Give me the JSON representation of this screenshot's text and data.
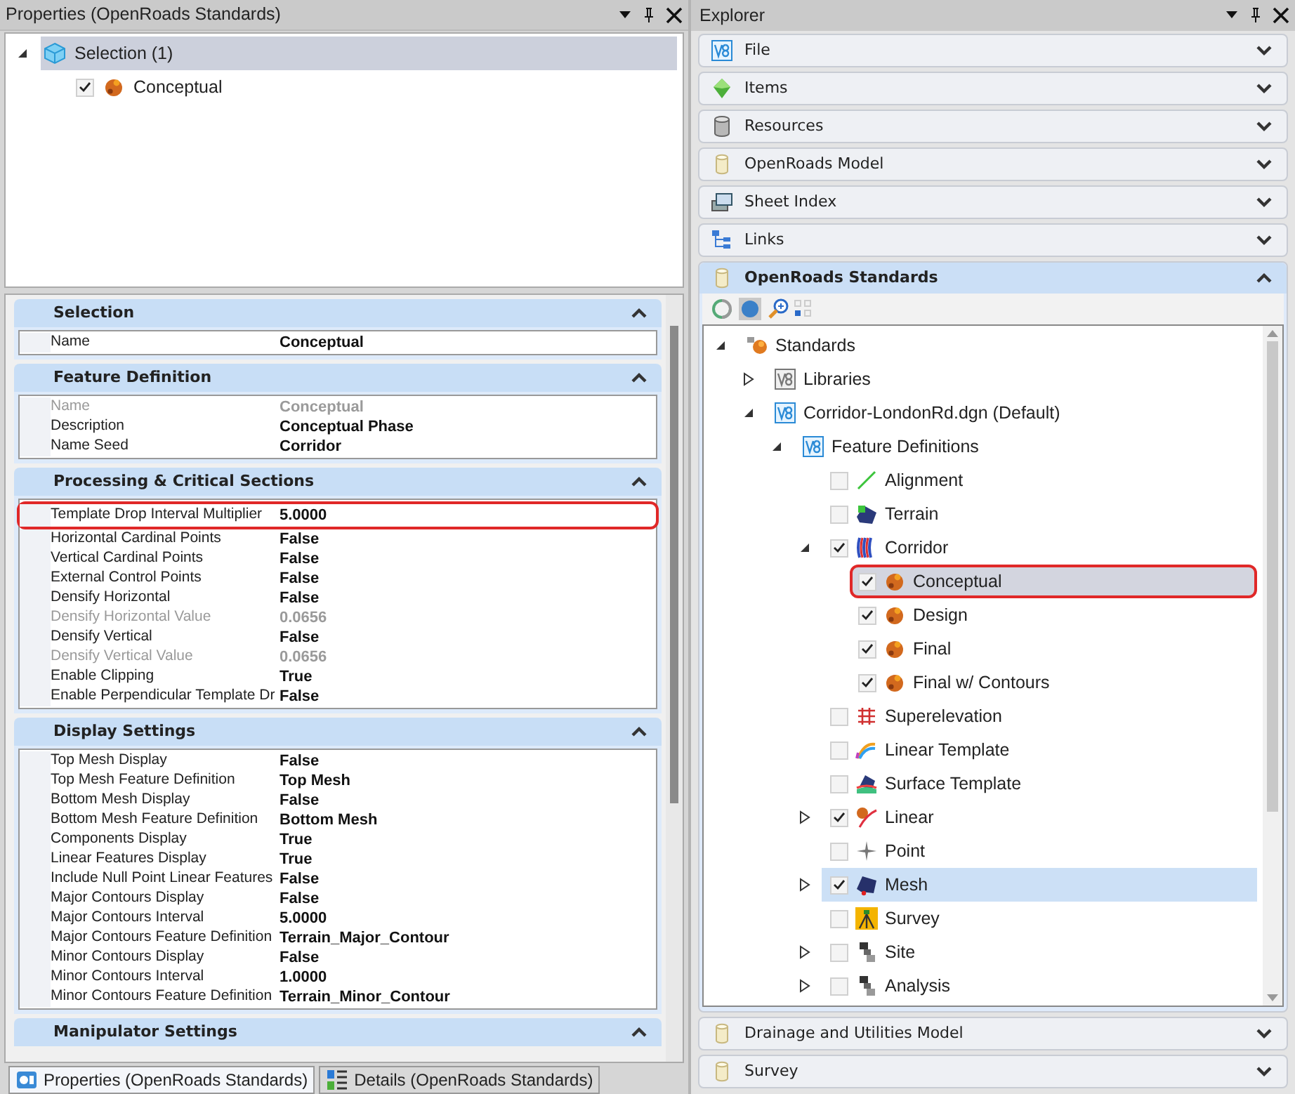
{
  "properties_panel": {
    "title": "Properties (OpenRoads Standards)",
    "selection_tree": [
      {
        "label": "Selection (1)",
        "kind": "cube",
        "expanded": true,
        "selected": true,
        "children": [
          {
            "label": "Conceptual",
            "kind": "palette",
            "checked": true,
            "selected": false
          }
        ]
      }
    ],
    "sections": [
      {
        "title": "Selection",
        "expanded": true,
        "rows": [
          {
            "name": "Name",
            "value": "Conceptual",
            "disabled": false,
            "highlighted": false
          }
        ]
      },
      {
        "title": "Feature Definition",
        "expanded": true,
        "rows": [
          {
            "name": "Name",
            "value": "Conceptual",
            "disabled": true,
            "highlighted": false
          },
          {
            "name": "Description",
            "value": "Conceptual Phase",
            "disabled": false,
            "highlighted": false
          },
          {
            "name": "Name Seed",
            "value": "Corridor",
            "disabled": false,
            "highlighted": false
          }
        ]
      },
      {
        "title": "Processing & Critical Sections",
        "expanded": true,
        "rows": [
          {
            "name": "Template Drop Interval Multiplier",
            "value": "5.0000",
            "disabled": false,
            "highlighted": true
          },
          {
            "name": "Horizontal Cardinal Points",
            "value": "False",
            "disabled": false,
            "highlighted": false
          },
          {
            "name": "Vertical Cardinal Points",
            "value": "False",
            "disabled": false,
            "highlighted": false
          },
          {
            "name": "External Control Points",
            "value": "False",
            "disabled": false,
            "highlighted": false
          },
          {
            "name": "Densify Horizontal",
            "value": "False",
            "disabled": false,
            "highlighted": false
          },
          {
            "name": "Densify Horizontal Value",
            "value": "0.0656",
            "disabled": true,
            "highlighted": false
          },
          {
            "name": "Densify Vertical",
            "value": "False",
            "disabled": false,
            "highlighted": false
          },
          {
            "name": "Densify Vertical Value",
            "value": "0.0656",
            "disabled": true,
            "highlighted": false
          },
          {
            "name": "Enable Clipping",
            "value": "True",
            "disabled": false,
            "highlighted": false
          },
          {
            "name": "Enable Perpendicular Template Dr",
            "value": "False",
            "disabled": false,
            "highlighted": false
          }
        ]
      },
      {
        "title": "Display Settings",
        "expanded": true,
        "rows": [
          {
            "name": "Top Mesh Display",
            "value": "False",
            "disabled": false,
            "highlighted": false
          },
          {
            "name": "Top Mesh Feature Definition",
            "value": "Top Mesh",
            "disabled": false,
            "highlighted": false
          },
          {
            "name": "Bottom Mesh Display",
            "value": "False",
            "disabled": false,
            "highlighted": false
          },
          {
            "name": "Bottom Mesh Feature Definition",
            "value": "Bottom Mesh",
            "disabled": false,
            "highlighted": false
          },
          {
            "name": "Components Display",
            "value": "True",
            "disabled": false,
            "highlighted": false
          },
          {
            "name": "Linear Features Display",
            "value": "True",
            "disabled": false,
            "highlighted": false
          },
          {
            "name": "Include Null Point Linear Features",
            "value": "False",
            "disabled": false,
            "highlighted": false
          },
          {
            "name": "Major Contours Display",
            "value": "False",
            "disabled": false,
            "highlighted": false
          },
          {
            "name": "Major Contours Interval",
            "value": "5.0000",
            "disabled": false,
            "highlighted": false
          },
          {
            "name": "Major Contours Feature Definition",
            "value": "Terrain_Major_Contour",
            "disabled": false,
            "highlighted": false
          },
          {
            "name": "Minor Contours Display",
            "value": "False",
            "disabled": false,
            "highlighted": false
          },
          {
            "name": "Minor Contours Interval",
            "value": "1.0000",
            "disabled": false,
            "highlighted": false
          },
          {
            "name": "Minor Contours Feature Definition",
            "value": "Terrain_Minor_Contour",
            "disabled": false,
            "highlighted": false
          }
        ]
      },
      {
        "title": "Manipulator Settings",
        "expanded": true
      }
    ],
    "tabs": [
      {
        "label": "Properties (OpenRoads Standards)",
        "kind": "properties",
        "selected": true
      },
      {
        "label": "Details (OpenRoads Standards)",
        "kind": "details",
        "selected": false
      }
    ]
  },
  "explorer": {
    "title": "Explorer",
    "sections": [
      {
        "label": "File",
        "kind": "v8",
        "expanded": false
      },
      {
        "label": "Items",
        "kind": "items",
        "expanded": false
      },
      {
        "label": "Resources",
        "kind": "resources",
        "expanded": false
      },
      {
        "label": "OpenRoads Model",
        "kind": "database",
        "expanded": false
      },
      {
        "label": "Sheet Index",
        "kind": "sheets",
        "expanded": false
      },
      {
        "label": "Links",
        "kind": "links",
        "expanded": false
      },
      {
        "label": "OpenRoads Standards",
        "kind": "database",
        "expanded": true,
        "tree": [
          {
            "label": "Standards",
            "kind": "standards",
            "expanded": true,
            "selected": false,
            "highlighted": false,
            "children": [
              {
                "label": "Libraries",
                "kind": "v8gray",
                "expanded": false,
                "selected": false,
                "highlighted": false
              },
              {
                "label": "Corridor-LondonRd.dgn (Default)",
                "kind": "v8",
                "expanded": true,
                "selected": false,
                "highlighted": false,
                "children": [
                  {
                    "label": "Feature Definitions",
                    "kind": "v8",
                    "expanded": true,
                    "selected": false,
                    "highlighted": false,
                    "children": [
                      {
                        "label": "Alignment",
                        "kind": "alignment",
                        "checked": false,
                        "selected": false,
                        "highlighted": false
                      },
                      {
                        "label": "Terrain",
                        "kind": "terrain",
                        "checked": false,
                        "selected": false,
                        "highlighted": false
                      },
                      {
                        "label": "Corridor",
                        "kind": "corridor",
                        "expanded": true,
                        "checked": true,
                        "selected": false,
                        "highlighted": false,
                        "children": [
                          {
                            "label": "Conceptual",
                            "kind": "palette",
                            "checked": true,
                            "selected": true,
                            "highlighted": true
                          },
                          {
                            "label": "Design",
                            "kind": "palette",
                            "checked": true,
                            "selected": false,
                            "highlighted": false
                          },
                          {
                            "label": "Final",
                            "kind": "palette",
                            "checked": true,
                            "selected": false,
                            "highlighted": false
                          },
                          {
                            "label": "Final w/ Contours",
                            "kind": "palette",
                            "checked": true,
                            "selected": false,
                            "highlighted": false
                          }
                        ]
                      },
                      {
                        "label": "Superelevation",
                        "kind": "superelevation",
                        "checked": false,
                        "selected": false,
                        "highlighted": false
                      },
                      {
                        "label": "Linear Template",
                        "kind": "lineartemplate",
                        "checked": false,
                        "selected": false,
                        "highlighted": false
                      },
                      {
                        "label": "Surface Template",
                        "kind": "surfacetemplate",
                        "checked": false,
                        "selected": false,
                        "highlighted": false
                      },
                      {
                        "label": "Linear",
                        "kind": "linear",
                        "expanded": false,
                        "checked": true,
                        "selected": false,
                        "highlighted": false
                      },
                      {
                        "label": "Point",
                        "kind": "point",
                        "checked": false,
                        "selected": false,
                        "highlighted": false
                      },
                      {
                        "label": "Mesh",
                        "kind": "mesh",
                        "expanded": false,
                        "checked": true,
                        "selected": true,
                        "highlighted": false
                      },
                      {
                        "label": "Survey",
                        "kind": "survey",
                        "checked": false,
                        "selected": false,
                        "highlighted": false
                      },
                      {
                        "label": "Site",
                        "kind": "site",
                        "expanded": false,
                        "checked": false,
                        "selected": false,
                        "highlighted": false
                      },
                      {
                        "label": "Analysis",
                        "kind": "site",
                        "expanded": false,
                        "checked": false,
                        "selected": false,
                        "highlighted": false
                      }
                    ]
                  }
                ]
              }
            ]
          }
        ]
      },
      {
        "label": "Drainage and Utilities Model",
        "kind": "database",
        "expanded": false
      },
      {
        "label": "Survey",
        "kind": "database",
        "expanded": false
      }
    ]
  }
}
